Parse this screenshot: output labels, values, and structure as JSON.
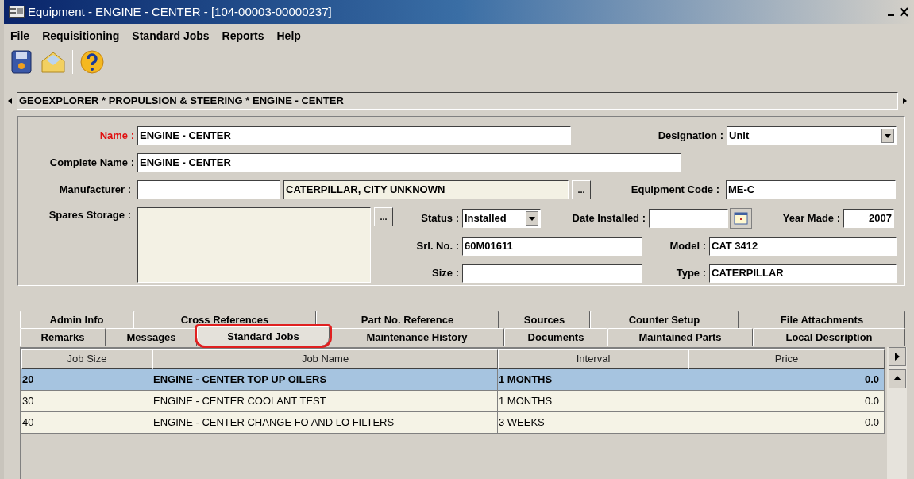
{
  "window": {
    "title": "Equipment - ENGINE - CENTER - [104-00003-00000237]"
  },
  "menu": [
    "File",
    "Requisitioning",
    "Standard Jobs",
    "Reports",
    "Help"
  ],
  "breadcrumb": "GEOEXPLORER * PROPULSION & STEERING * ENGINE - CENTER",
  "form": {
    "name": {
      "label": "Name :",
      "value": "ENGINE - CENTER",
      "required": true
    },
    "designation": {
      "label": "Designation :",
      "value": "Unit",
      "required": false
    },
    "complete_name": {
      "label": "Complete Name :",
      "value": "ENGINE - CENTER",
      "required": false
    },
    "manufacturer": {
      "label": "Manufacturer :",
      "value_2": "CATERPILLAR, CITY UNKNOWN",
      "required": false
    },
    "equipment_code": {
      "label": "Equipment Code :",
      "value": "ME-C",
      "required": false
    },
    "spares_storage": {
      "label": "Spares Storage :",
      "required": false
    },
    "status": {
      "label": "Status :",
      "value": "Installed",
      "required": false
    },
    "date_installed": {
      "label": "Date Installed :",
      "required": false
    },
    "year_made": {
      "label": "Year Made :",
      "value": "2007",
      "required": false
    },
    "srl_no": {
      "label": "Srl. No. :",
      "value": "60M01611",
      "required": false
    },
    "model": {
      "label": "Model :",
      "value": "CAT 3412",
      "required": false
    },
    "size": {
      "label": "Size :",
      "required": false
    },
    "type": {
      "label": "Type :",
      "value": "CATERPILLAR",
      "required": false
    },
    "browse_button": "..."
  },
  "tabs": {
    "back_row": [
      {
        "label": "Admin Info",
        "selected": false,
        "circled": false
      },
      {
        "label": "Cross References",
        "selected": false,
        "circled": false
      },
      {
        "label": "Part No. Reference",
        "selected": false,
        "circled": false
      },
      {
        "label": "Sources",
        "selected": false,
        "circled": false
      },
      {
        "label": "Counter Setup",
        "selected": false,
        "circled": false
      },
      {
        "label": "File Attachments",
        "selected": false,
        "circled": false
      }
    ],
    "front_row": [
      {
        "label": "Remarks",
        "selected": false,
        "circled": false
      },
      {
        "label": "Messages",
        "selected": false,
        "circled": false
      },
      {
        "label": "Standard Jobs",
        "selected": true,
        "circled": true
      },
      {
        "label": "Maintenance History",
        "selected": false,
        "circled": false
      },
      {
        "label": "Documents",
        "selected": false,
        "circled": false
      },
      {
        "label": "Maintained Parts",
        "selected": false,
        "circled": false
      },
      {
        "label": "Local Description",
        "selected": false,
        "circled": false
      }
    ]
  },
  "table": {
    "columns": [
      "Job Size",
      "Job Name",
      "Interval",
      "Price"
    ],
    "rows": [
      {
        "cells": [
          "20",
          "ENGINE - CENTER TOP UP OILERS",
          "1 MONTHS",
          "0.0"
        ],
        "selected": true
      },
      {
        "cells": [
          "30",
          "ENGINE - CENTER COOLANT TEST",
          "1 MONTHS",
          "0.0"
        ],
        "selected": false
      },
      {
        "cells": [
          "40",
          "ENGINE - CENTER CHANGE FO AND LO FILTERS",
          "3 WEEKS",
          "0.0"
        ],
        "selected": false
      }
    ]
  }
}
